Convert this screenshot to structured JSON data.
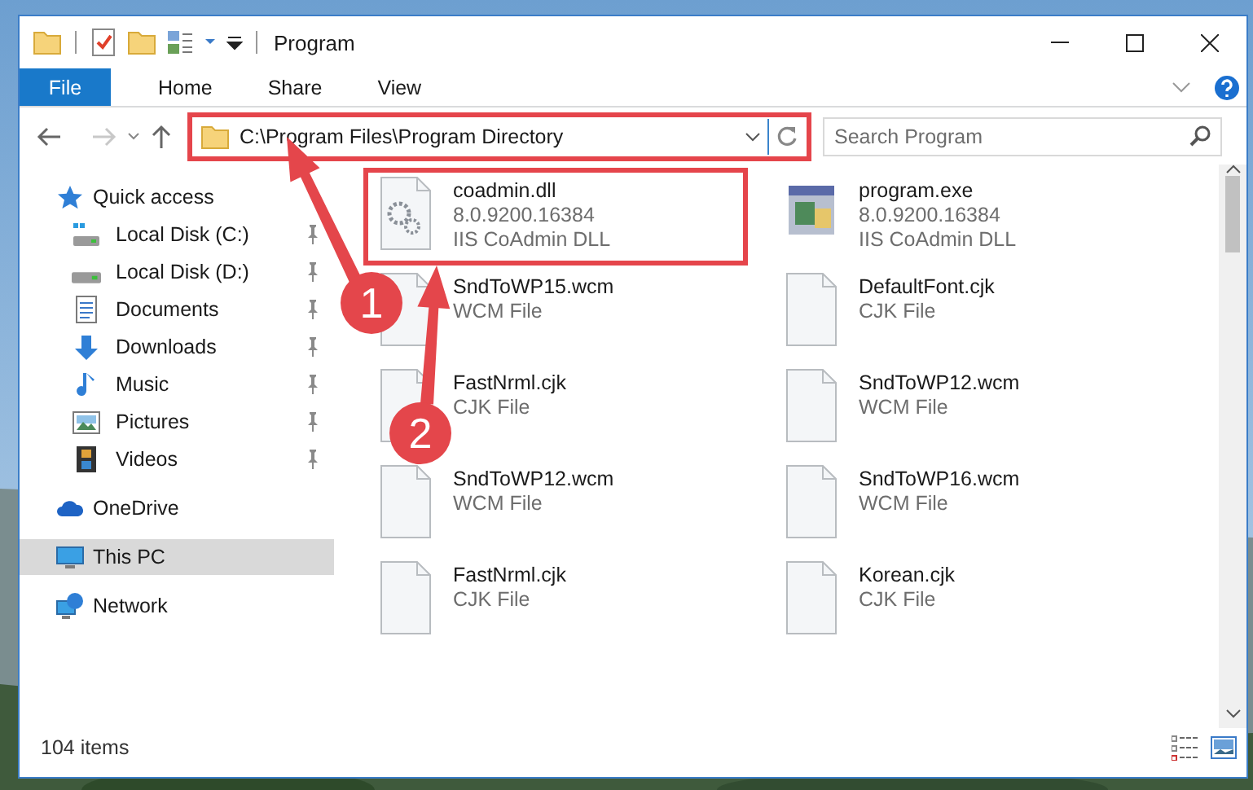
{
  "window": {
    "title": "Program"
  },
  "ribbon_tabs": [
    {
      "label": "File",
      "kind": "file"
    },
    {
      "label": "Home",
      "kind": "tab"
    },
    {
      "label": "Share",
      "kind": "tab"
    },
    {
      "label": "View",
      "kind": "tab"
    }
  ],
  "address_bar": {
    "path": "C:\\Program Files\\Program Directory",
    "highlighted": true
  },
  "search": {
    "placeholder": "Search Program"
  },
  "sidebar": {
    "items": [
      {
        "label": "Quick access",
        "selected": false,
        "children": [
          {
            "label": "Local Disk (C:)",
            "selected": false,
            "pinned": true
          },
          {
            "label": "Local Disk (D:)",
            "selected": false,
            "pinned": true
          },
          {
            "label": "Documents",
            "selected": false,
            "pinned": true
          },
          {
            "label": "Downloads",
            "selected": false,
            "pinned": true
          },
          {
            "label": "Music",
            "selected": false,
            "pinned": true
          },
          {
            "label": "Pictures",
            "selected": false,
            "pinned": true
          },
          {
            "label": "Videos",
            "selected": false,
            "pinned": true
          }
        ]
      },
      {
        "label": "OneDrive",
        "selected": false
      },
      {
        "label": "This PC",
        "selected": true
      },
      {
        "label": "Network",
        "selected": false
      }
    ]
  },
  "files": [
    {
      "kind": "dll",
      "name": "coadmin.dll",
      "details": [
        "8.0.9200.16384",
        "IIS CoAdmin DLL"
      ],
      "highlighted": true
    },
    {
      "kind": "exe",
      "name": "program.exe",
      "details": [
        "8.0.9200.16384",
        "IIS CoAdmin DLL"
      ],
      "highlighted": false
    },
    {
      "kind": "file",
      "name": "SndToWP15.wcm",
      "details": [
        "WCM File"
      ],
      "highlighted": false
    },
    {
      "kind": "file",
      "name": "DefaultFont.cjk",
      "details": [
        "CJK File"
      ],
      "highlighted": false
    },
    {
      "kind": "file",
      "name": "FastNrml.cjk",
      "details": [
        "CJK File"
      ],
      "highlighted": false
    },
    {
      "kind": "file",
      "name": "SndToWP12.wcm",
      "details": [
        "WCM File"
      ],
      "highlighted": false
    },
    {
      "kind": "file",
      "name": "SndToWP12.wcm",
      "details": [
        "WCM File"
      ],
      "highlighted": false
    },
    {
      "kind": "file",
      "name": "SndToWP16.wcm",
      "details": [
        "WCM File"
      ],
      "highlighted": false
    },
    {
      "kind": "file",
      "name": "FastNrml.cjk",
      "details": [
        "CJK File"
      ],
      "highlighted": false
    },
    {
      "kind": "file",
      "name": "Korean.cjk",
      "details": [
        "CJK File"
      ],
      "highlighted": false
    }
  ],
  "status_bar": {
    "item_count": "104 items"
  },
  "annotations": [
    {
      "label": "1"
    },
    {
      "label": "2"
    }
  ]
}
